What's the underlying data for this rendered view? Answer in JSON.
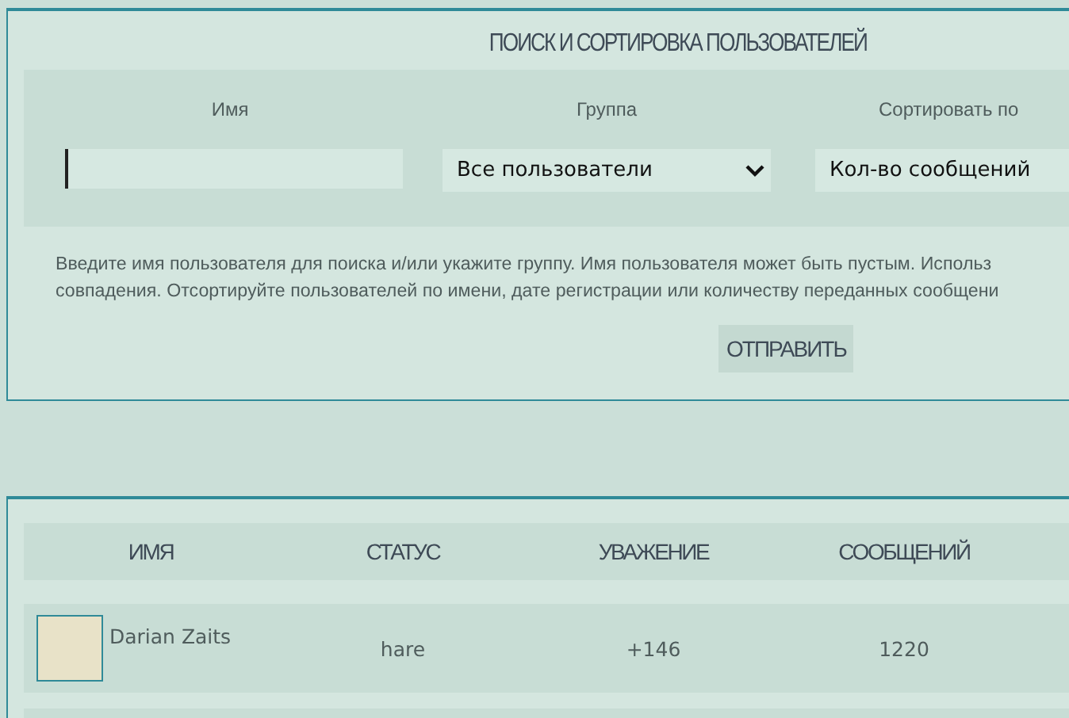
{
  "search_panel": {
    "title": "ПОИСК И СОРТИРОВКА ПОЛЬЗОВАТЕЛЕЙ",
    "fields": [
      {
        "kind": "text",
        "label": "Имя"
      },
      {
        "kind": "select",
        "label": "Группа",
        "value": "Все пользователи"
      },
      {
        "kind": "select",
        "label": "Сортировать по",
        "value": "Кол-во сообщений"
      }
    ],
    "help_lines": [
      "Введите имя пользователя для поиска и/или укажите группу. Имя пользователя может быть пустым. Использ",
      "совпадения. Отсортируйте пользователей по имени, дате регистрации или количеству переданных сообщени"
    ],
    "submit_button": "ОТПРАВИТЬ"
  },
  "users_table": {
    "columns": [
      "ИМЯ",
      "СТАТУС",
      "УВАЖЕНИЕ",
      "СООБЩЕНИЙ"
    ],
    "rows": [
      {
        "name": "Darian Zaits",
        "status": "hare",
        "respect": "+146",
        "posts": "1220"
      }
    ]
  }
}
